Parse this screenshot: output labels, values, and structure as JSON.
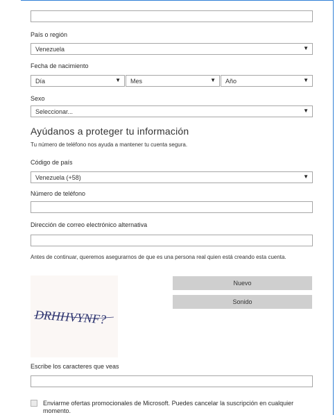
{
  "form": {
    "country_region_label": "País o región",
    "country_region_value": "Venezuela",
    "birthdate_label": "Fecha de nacimiento",
    "day_value": "Día",
    "month_value": "Mes",
    "year_value": "Año",
    "gender_label": "Sexo",
    "gender_value": "Seleccionar...",
    "protect_heading": "Ayúdanos a proteger tu información",
    "protect_desc": "Tu número de teléfono nos ayuda a mantener tu cuenta segura.",
    "country_code_label": "Código de país",
    "country_code_value": "Venezuela (+58)",
    "phone_label": "Número de teléfono",
    "phone_value": "",
    "alt_email_label": "Dirección de correo electrónico alternativa",
    "alt_email_value": "",
    "captcha_intro": "Antes de continuar, queremos asegurarnos de que es una persona real quien está creando esta cuenta.",
    "captcha_text": "DRHHVYNF?",
    "new_button": "Nuevo",
    "audio_button": "Sonido",
    "captcha_input_label": "Escribe los caracteres que veas",
    "captcha_input_value": "",
    "promo_text": "Enviarme ofertas promocionales de Microsoft. Puedes cancelar la suscripción en cualquier momento."
  },
  "icons": {
    "dropdown_arrow": "▼"
  }
}
